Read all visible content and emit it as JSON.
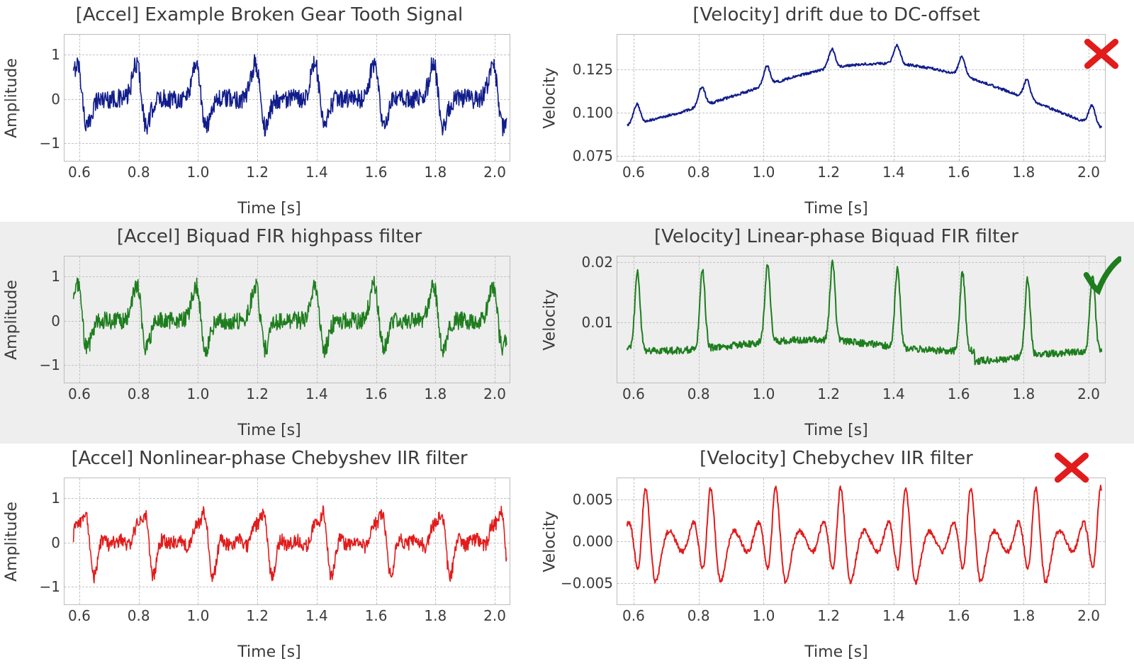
{
  "chart_data": [
    {
      "id": "accel_raw",
      "type": "line",
      "title": "[Accel] Example Broken Gear Tooth Signal",
      "xlabel": "Time [s]",
      "ylabel": "Amplitude",
      "xlim": [
        0.55,
        2.05
      ],
      "ylim": [
        -1.4,
        1.45
      ],
      "xticks": [
        0.6,
        0.8,
        1.0,
        1.2,
        1.4,
        1.6,
        1.8,
        2.0
      ],
      "yticks": [
        -1,
        0,
        1
      ],
      "color": "#111d8b",
      "series_kind": "accel_spikes",
      "series_params": {
        "noise": 0.22,
        "amp": 1.0,
        "phase_shift": 0.0
      },
      "mark": null
    },
    {
      "id": "vel_drift",
      "type": "line",
      "title": "[Velocity] drift due to DC-offset",
      "xlabel": "Time [s]",
      "ylabel": "Velocity",
      "xlim": [
        0.55,
        2.05
      ],
      "ylim": [
        0.072,
        0.145
      ],
      "xticks": [
        0.6,
        0.8,
        1.0,
        1.2,
        1.4,
        1.6,
        1.8,
        2.0
      ],
      "yticks": [
        0.075,
        0.1,
        0.125
      ],
      "color": "#111d8b",
      "series_kind": "drift_with_bumps",
      "series_params": {},
      "mark": "cross"
    },
    {
      "id": "accel_fir",
      "type": "line",
      "title": "[Accel] Biquad FIR highpass filter",
      "xlabel": "Time [s]",
      "ylabel": "Amplitude",
      "xlim": [
        0.55,
        2.05
      ],
      "ylim": [
        -1.4,
        1.45
      ],
      "xticks": [
        0.6,
        0.8,
        1.0,
        1.2,
        1.4,
        1.6,
        1.8,
        2.0
      ],
      "yticks": [
        -1,
        0,
        1
      ],
      "color": "#1e7d1e",
      "series_kind": "accel_spikes",
      "series_params": {
        "noise": 0.2,
        "amp": 1.0,
        "phase_shift": 0.0
      },
      "mark": null
    },
    {
      "id": "vel_fir",
      "type": "line",
      "title": "[Velocity] Linear-phase Biquad FIR filter",
      "xlabel": "Time [s]",
      "ylabel": "Velocity",
      "xlim": [
        0.55,
        2.05
      ],
      "ylim": [
        0.0,
        0.021
      ],
      "xticks": [
        0.6,
        0.8,
        1.0,
        1.2,
        1.4,
        1.6,
        1.8,
        2.0
      ],
      "yticks": [
        0.01,
        0.02
      ],
      "color": "#1e7d1e",
      "series_kind": "vel_peaks",
      "series_params": {},
      "mark": "check"
    },
    {
      "id": "accel_iir",
      "type": "line",
      "title": "[Accel] Nonlinear-phase Chebyshev IIR filter",
      "xlabel": "Time [s]",
      "ylabel": "Amplitude",
      "xlim": [
        0.55,
        2.05
      ],
      "ylim": [
        -1.4,
        1.45
      ],
      "xticks": [
        0.6,
        0.8,
        1.0,
        1.2,
        1.4,
        1.6,
        1.8,
        2.0
      ],
      "yticks": [
        -1,
        0,
        1
      ],
      "color": "#e21b1b",
      "series_kind": "accel_spikes",
      "series_params": {
        "noise": 0.16,
        "amp": 1.0,
        "phase_shift": 0.02,
        "ringing": true
      },
      "mark": null
    },
    {
      "id": "vel_iir",
      "type": "line",
      "title": "[Velocity] Chebychev IIR filter",
      "xlabel": "Time [s]",
      "ylabel": "Velocity",
      "xlim": [
        0.55,
        2.05
      ],
      "ylim": [
        -0.0075,
        0.0075
      ],
      "xticks": [
        0.6,
        0.8,
        1.0,
        1.2,
        1.4,
        1.6,
        1.8,
        2.0
      ],
      "yticks": [
        -0.005,
        0.0,
        0.005
      ],
      "color": "#e21b1b",
      "series_kind": "iir_ringing",
      "series_params": {},
      "mark": "cross"
    }
  ],
  "layout": {
    "rows": 3,
    "cols": 2,
    "row_bg": [
      false,
      true,
      false
    ]
  },
  "marks": {
    "cross": {
      "color": "#e21b1b"
    },
    "check": {
      "color": "#1e7d1e"
    }
  },
  "labels": {
    "xlabel": "Time [s]",
    "ylabel_left": "Amplitude",
    "ylabel_right": "Velocity"
  }
}
